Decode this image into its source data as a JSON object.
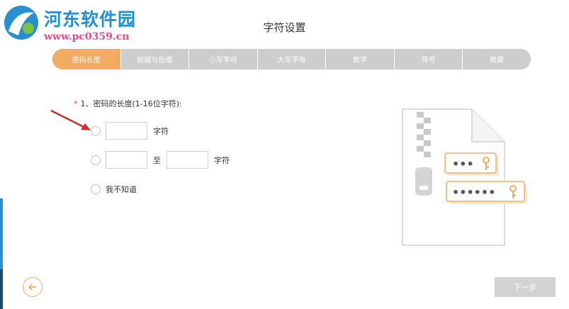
{
  "watermark": {
    "name": "河东软件园",
    "url": "www.pc0359.cn"
  },
  "page": {
    "title": "字符设置"
  },
  "steps": [
    {
      "label": "密码长度",
      "active": true
    },
    {
      "label": "前缀与后缀",
      "active": false
    },
    {
      "label": "小写字母",
      "active": false
    },
    {
      "label": "大写字母",
      "active": false
    },
    {
      "label": "数字",
      "active": false
    },
    {
      "label": "符号",
      "active": false
    },
    {
      "label": "概要",
      "active": false
    }
  ],
  "question": {
    "required_mark": "*",
    "text": "1、密码的长度(1-16位字符):"
  },
  "options": {
    "exact": {
      "value": "",
      "unit": "字符"
    },
    "range": {
      "from_value": "",
      "separator": "至",
      "to_value": "",
      "unit": "字符"
    },
    "unknown": {
      "label": "我不知道"
    }
  },
  "illustration": {
    "password_short_mask": "•••",
    "password_long_mask": "••••••"
  },
  "footer": {
    "back_icon": "arrow-left-icon",
    "next_label": "下一步"
  },
  "colors": {
    "accent": "#f3ab61",
    "step_inactive": "#cdcdcd",
    "required": "#e0482a",
    "button_disabled": "#d3d3d3"
  }
}
